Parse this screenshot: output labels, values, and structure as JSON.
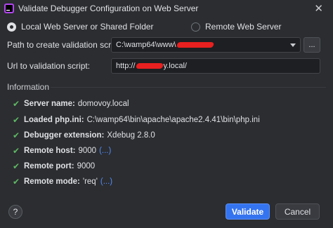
{
  "window": {
    "title": "Validate Debugger Configuration on Web Server"
  },
  "mode": {
    "local_label": "Local Web Server or Shared Folder",
    "remote_label": "Remote Web Server",
    "selected": "local"
  },
  "form": {
    "path_label": "Path to create validation script:",
    "path_value": "C:\\wamp64\\www\\",
    "browse_label": "...",
    "url_label": "Url to validation script:",
    "url_prefix": "http://",
    "url_suffix": "y.local/"
  },
  "information": {
    "title": "Information",
    "rows": [
      {
        "key": "Server name:",
        "value": "domovoy.local",
        "link": ""
      },
      {
        "key": "Loaded php.ini:",
        "value": "C:\\wamp64\\bin\\apache\\apache2.4.41\\bin\\php.ini",
        "link": ""
      },
      {
        "key": "Debugger extension:",
        "value": "Xdebug 2.8.0",
        "link": ""
      },
      {
        "key": "Remote host:",
        "value": "9000",
        "link": "(...)"
      },
      {
        "key": "Remote port:",
        "value": "9000",
        "link": ""
      },
      {
        "key": "Remote mode:",
        "value": "'req'",
        "link": "(...)"
      }
    ]
  },
  "buttons": {
    "help": "?",
    "validate": "Validate",
    "cancel": "Cancel"
  },
  "colors": {
    "accent": "#3574f0",
    "check": "#5fb865",
    "link": "#548af7",
    "redaction": "#e8201f"
  }
}
